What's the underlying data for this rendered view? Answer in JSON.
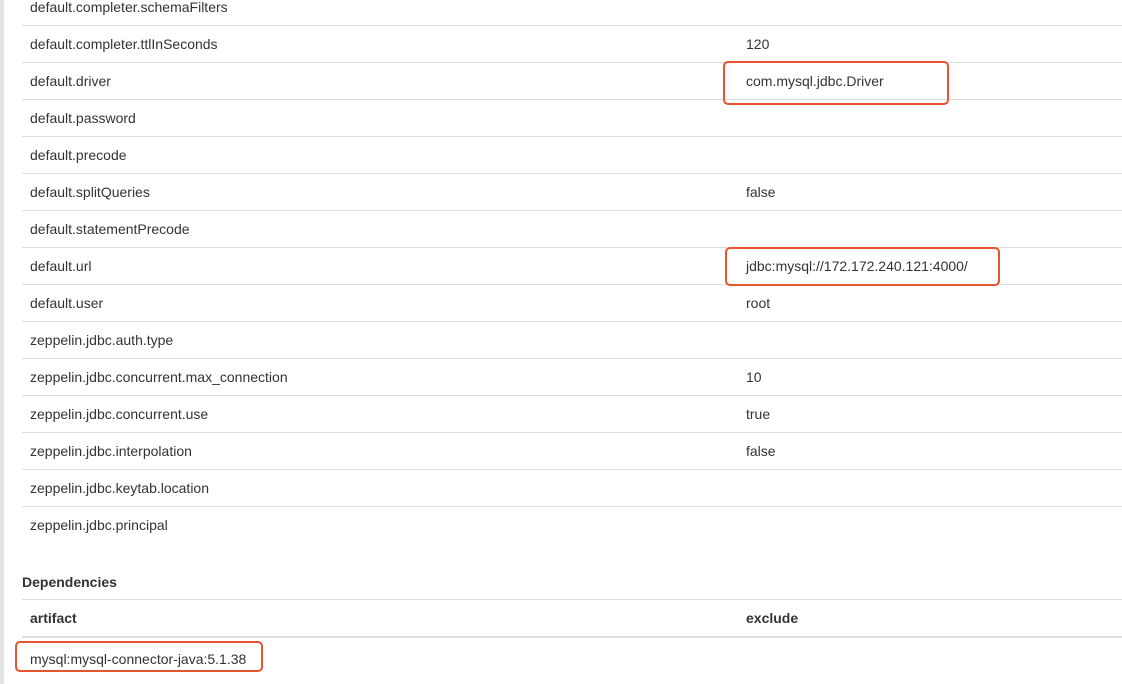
{
  "properties": [
    {
      "name": "default.completer.schemaFilters",
      "value": ""
    },
    {
      "name": "default.completer.ttlInSeconds",
      "value": "120"
    },
    {
      "name": "default.driver",
      "value": "com.mysql.jdbc.Driver"
    },
    {
      "name": "default.password",
      "value": ""
    },
    {
      "name": "default.precode",
      "value": ""
    },
    {
      "name": "default.splitQueries",
      "value": "false"
    },
    {
      "name": "default.statementPrecode",
      "value": ""
    },
    {
      "name": "default.url",
      "value": "jdbc:mysql://172.172.240.121:4000/"
    },
    {
      "name": "default.user",
      "value": "root"
    },
    {
      "name": "zeppelin.jdbc.auth.type",
      "value": ""
    },
    {
      "name": "zeppelin.jdbc.concurrent.max_connection",
      "value": "10"
    },
    {
      "name": "zeppelin.jdbc.concurrent.use",
      "value": "true"
    },
    {
      "name": "zeppelin.jdbc.interpolation",
      "value": "false"
    },
    {
      "name": "zeppelin.jdbc.keytab.location",
      "value": ""
    },
    {
      "name": "zeppelin.jdbc.principal",
      "value": ""
    }
  ],
  "dependencies": {
    "title": "Dependencies",
    "columns": {
      "artifact": "artifact",
      "exclude": "exclude"
    },
    "rows": [
      {
        "artifact": "mysql:mysql-connector-java:5.1.38",
        "exclude": ""
      }
    ]
  },
  "annotation_color": "#e8542e"
}
